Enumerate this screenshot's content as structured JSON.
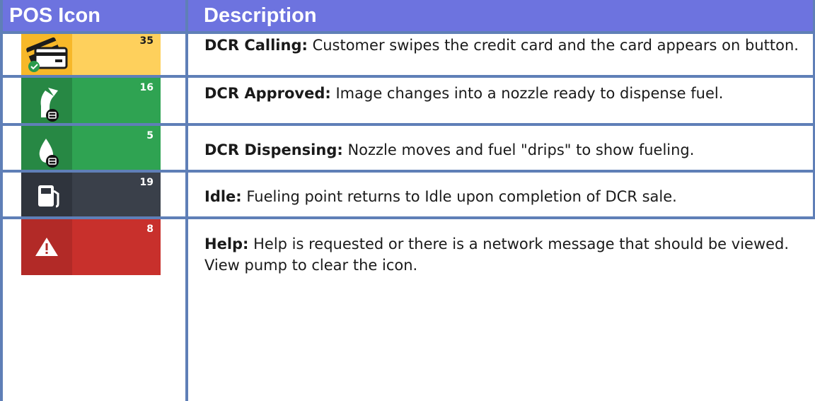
{
  "header": {
    "col1": "POS Icon",
    "col2": "Description"
  },
  "rows": [
    {
      "count": "35",
      "term": "DCR Calling:",
      "text": " Customer swipes the credit card and the card appears on button.",
      "bg": "#fbc44a",
      "icon": "credit-card-check-icon"
    },
    {
      "count": "16",
      "term": "DCR Approved:",
      "text": " Image changes into a nozzle ready to dispense fuel.",
      "bg": "#2a9a4b",
      "icon": "fuel-nozzle-icon"
    },
    {
      "count": "5",
      "term": "DCR Dispensing:",
      "text": " Nozzle moves and fuel \"drips\" to show fueling.",
      "bg": "#2a9a4b",
      "icon": "fuel-drip-icon"
    },
    {
      "count": "19",
      "term": "Idle:",
      "text": " Fueling point returns to Idle upon completion of DCR sale.",
      "bg": "#353b45",
      "icon": "fuel-pump-icon"
    },
    {
      "count": "8",
      "term": "Help:",
      "text": " Help is requested or there is a network message that should be viewed.  View pump to clear the icon.",
      "bg": "#c8302c",
      "icon": "warning-icon"
    }
  ]
}
